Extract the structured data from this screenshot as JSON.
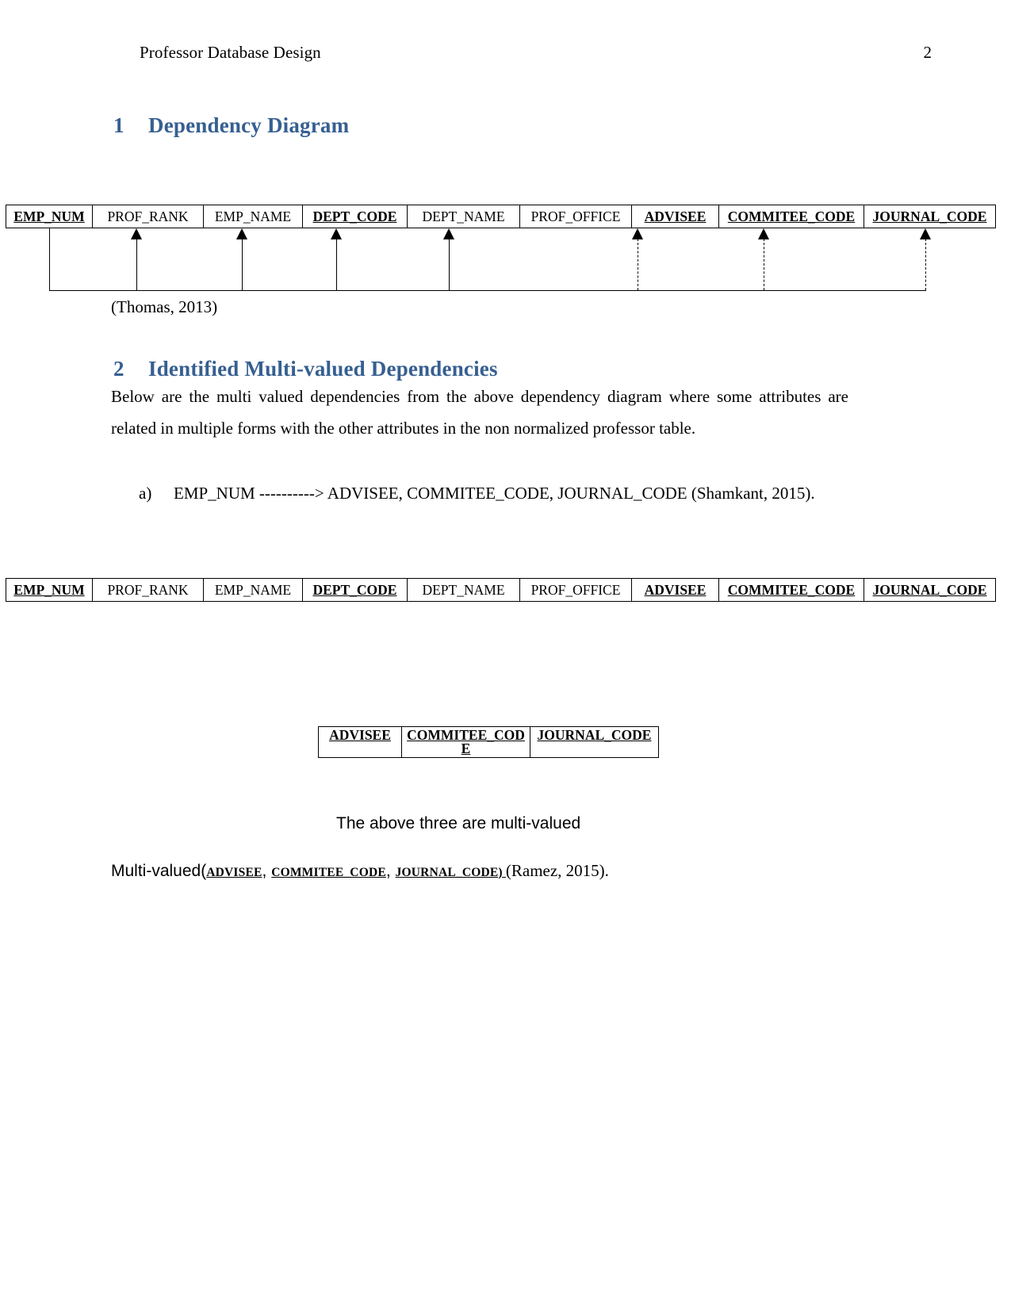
{
  "header": {
    "title": "Professor Database Design",
    "page_number": "2"
  },
  "sections": [
    {
      "number": "1",
      "title": "Dependency Diagram"
    },
    {
      "number": "2",
      "title": "Identified Multi-valued Dependencies"
    }
  ],
  "dependency_table": {
    "columns": [
      {
        "label": "EMP_NUM",
        "key": true
      },
      {
        "label": "PROF_RANK",
        "key": false
      },
      {
        "label": "EMP_NAME",
        "key": false
      },
      {
        "label": "DEPT_CODE",
        "key": true
      },
      {
        "label": "DEPT_NAME",
        "key": false
      },
      {
        "label": "PROF_OFFICE",
        "key": false
      },
      {
        "label": "ADVISEE",
        "key": true
      },
      {
        "label": "COMMITEE_CODE",
        "key": true
      },
      {
        "label": "JOURNAL_CODE",
        "key": true
      }
    ]
  },
  "diagram_caption": "(Thomas, 2013)",
  "body": {
    "intro": "Below are the multi valued dependencies from the above dependency diagram where some attributes are related in multiple forms with the other attributes in the non normalized professor table.",
    "list": [
      {
        "marker": "a)",
        "text": "EMP_NUM ----------> ADVISEE, COMMITEE_CODE, JOURNAL_CODE (Shamkant, 2015)."
      }
    ]
  },
  "second_table": {
    "columns": [
      {
        "label": "EMP_NUM",
        "key": true
      },
      {
        "label": "PROF_RANK",
        "key": false
      },
      {
        "label": "EMP_NAME",
        "key": false
      },
      {
        "label": "DEPT_CODE",
        "key": true
      },
      {
        "label": "DEPT_NAME",
        "key": false
      },
      {
        "label": "PROF_OFFICE",
        "key": false
      },
      {
        "label": "ADVISEE",
        "key": true
      },
      {
        "label": "COMMITEE_CODE",
        "key": true
      },
      {
        "label": "JOURNAL_CODE",
        "key": true
      }
    ]
  },
  "multivalued_table": {
    "columns": [
      {
        "label": "ADVISEE"
      },
      {
        "label": "COMMITEE_COD E"
      },
      {
        "label": "JOURNAL_CODE"
      }
    ]
  },
  "note": "The above three are multi-valued",
  "final_line": {
    "prefix": "Multi-valued(",
    "items": [
      {
        "label": "ADVISEE",
        "sep": ", "
      },
      {
        "label": "COMMITEE_CODE",
        "sep": ", "
      },
      {
        "label": "JOURNAL_CODE) ",
        "sep": ""
      }
    ],
    "suffix": "(Ramez, 2015)."
  },
  "colors": {
    "heading": "#365F91",
    "text": "#000000",
    "rule": "#000000"
  }
}
